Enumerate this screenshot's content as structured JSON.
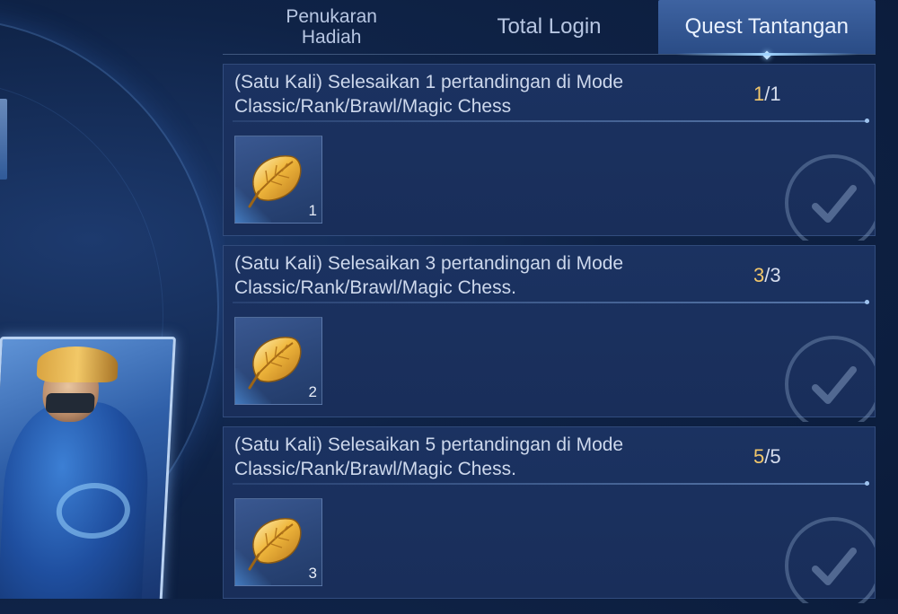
{
  "tabs": [
    {
      "label": "Penukaran Hadiah",
      "active": false
    },
    {
      "label": "Total Login",
      "active": false
    },
    {
      "label": "Quest Tantangan",
      "active": true
    }
  ],
  "quests": [
    {
      "title": "(Satu Kali) Selesaikan 1 pertandingan di Mode Classic/Rank/Brawl/Magic Chess",
      "progress_done": "1",
      "progress_total": "/1",
      "reward_icon": "golden-leaf-icon",
      "reward_qty": "1",
      "status_icon": "claimed-check-icon"
    },
    {
      "title": "(Satu Kali) Selesaikan 3 pertandingan di Mode Classic/Rank/Brawl/Magic Chess.",
      "progress_done": "3",
      "progress_total": "/3",
      "reward_icon": "golden-leaf-icon",
      "reward_qty": "2",
      "status_icon": "claimed-check-icon"
    },
    {
      "title": "(Satu Kali) Selesaikan 5 pertandingan di Mode Classic/Rank/Brawl/Magic Chess.",
      "progress_done": "5",
      "progress_total": "/5",
      "reward_icon": "golden-leaf-icon",
      "reward_qty": "3",
      "status_icon": "claimed-check-icon"
    }
  ],
  "colors": {
    "accent_gold": "#f2c76a",
    "panel_bg": "#1b3261",
    "active_tab": "#3e63a1"
  }
}
